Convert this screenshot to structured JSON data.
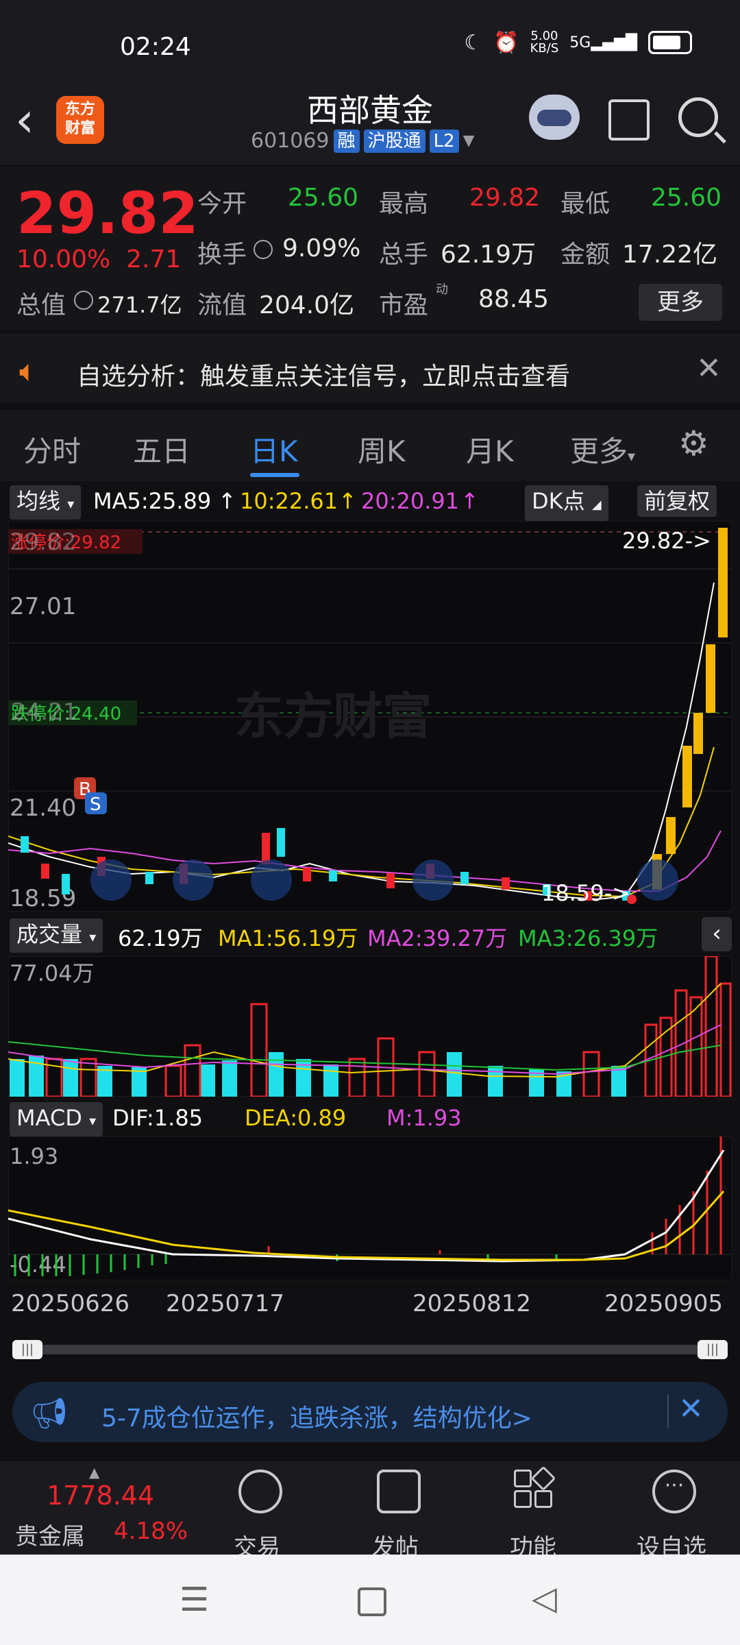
{
  "status": {
    "time": "02:24",
    "net_speed": "5.00\nKB/S",
    "network": "5G"
  },
  "header": {
    "logo_line1": "东方",
    "logo_line2": "财富",
    "name": "西部黄金",
    "code": "601069",
    "tag_rong": "融",
    "tag_hgt": "沪股通",
    "tag_l2": "L2"
  },
  "quote": {
    "price": "29.82",
    "pct": "10.00%",
    "change": "2.71",
    "open_label": "今开",
    "open": "25.60",
    "high_label": "最高",
    "high": "29.82",
    "low_label": "最低",
    "low": "25.60",
    "turnover_label": "换手",
    "turnover": "9.09%",
    "volume_label": "总手",
    "volume": "62.19万",
    "amount_label": "金额",
    "amount": "17.22亿",
    "mktcap_label": "总值",
    "mktcap": "271.7亿",
    "float_label": "流值",
    "float": "204.0亿",
    "pe_label": "市盈",
    "pe_sup": "动",
    "pe": "88.45",
    "more": "更多"
  },
  "notice": {
    "text": "自选分析：触发重点关注信号，立即点击查看"
  },
  "tabs": [
    "分时",
    "五日",
    "日K",
    "周K",
    "月K",
    "更多"
  ],
  "kbar": {
    "ma_select": "均线",
    "ma5": "MA5:25.89",
    "ma10": "10:22.61",
    "ma20": "20:20.91",
    "dk": "DK点",
    "adj": "前复权"
  },
  "kchart": {
    "price_top": "29.82",
    "price_27": "27.01",
    "price_2421": "24.21",
    "price_2140": "21.40",
    "price_low": "18.59",
    "limit_up": "涨停价:29.82",
    "limit_down": "跌停价:24.40",
    "last_label": "29.82->",
    "low_label": "18.59->",
    "watermark": "东方财富",
    "buy": "B",
    "sell": "S"
  },
  "vol": {
    "select": "成交量",
    "value": "62.19万",
    "ma1": "MA1:56.19万",
    "ma2": "MA2:39.27万",
    "ma3": "MA3:26.39万",
    "top": "77.04万"
  },
  "macd": {
    "select": "MACD",
    "dif": "DIF:1.85",
    "dea": "DEA:0.89",
    "m": "M:1.93",
    "top": "1.93",
    "bottom": "-0.44"
  },
  "dates": [
    "20250626",
    "20250717",
    "20250812",
    "20250905"
  ],
  "banner": {
    "text": "5-7成仓位运作，追跌杀涨，结构优化>"
  },
  "bottom": {
    "index_value": "1778.44",
    "index_name": "贵金属",
    "index_pct": "4.18%",
    "trade": "交易",
    "post": "发帖",
    "func": "功能",
    "fav": "设自选"
  },
  "colors": {
    "up": "#f0242c",
    "down": "#22c43a",
    "accent": "#3a8cf0",
    "ma5": "#ffffff",
    "ma10": "#f5d400",
    "ma20": "#e04ce0"
  }
}
